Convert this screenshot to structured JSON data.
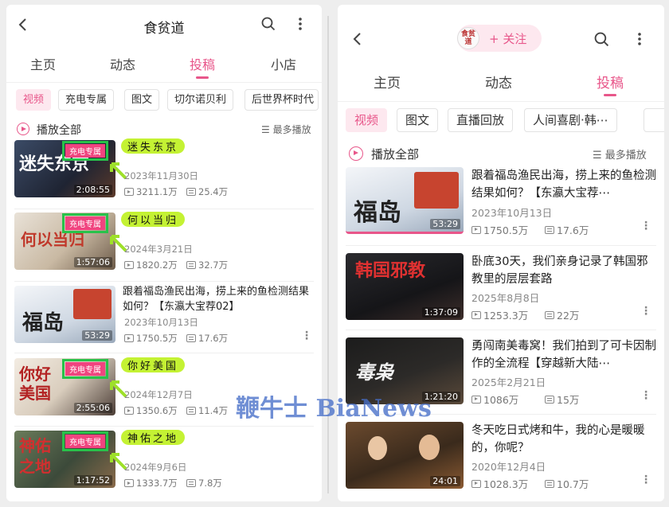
{
  "left": {
    "title": "食贫道",
    "tabs": [
      "主页",
      "动态",
      "投稿",
      "小店"
    ],
    "chips": [
      "视频",
      "充电专属",
      "图文",
      "切尔诺贝利",
      "后世界杯时代"
    ],
    "play_all": "播放全部",
    "sort": "最多播放",
    "videos": [
      {
        "title": "",
        "highlight": "迷失东京",
        "badge": "充电专属",
        "date": "2023年11月30日",
        "views": "3211.1万",
        "danmaku": "25.4万",
        "duration": "2:08:55",
        "thumb_text": "迷失东京"
      },
      {
        "title": "",
        "highlight": "何以当归",
        "badge": "充电专属",
        "date": "2024年3月21日",
        "views": "1820.2万",
        "danmaku": "32.7万",
        "duration": "1:57:06",
        "thumb_text": "何以当归"
      },
      {
        "title": "跟着福岛渔民出海，捞上来的鱼检测结果如何？【东瀛大宝荐02】",
        "highlight": "",
        "badge": "",
        "date": "2023年10月13日",
        "views": "1750.5万",
        "danmaku": "17.6万",
        "duration": "53:29",
        "thumb_text": "福岛"
      },
      {
        "title": "",
        "highlight": "你好美国",
        "badge": "充电专属",
        "date": "2024年12月7日",
        "views": "1350.6万",
        "danmaku": "11.4万",
        "duration": "2:55:06",
        "thumb_text": "你好美国"
      },
      {
        "title": "",
        "highlight": "神佑之地",
        "badge": "充电专属",
        "date": "2024年9月6日",
        "views": "1333.7万",
        "danmaku": "7.8万",
        "duration": "1:17:52",
        "thumb_text": "神佑之地"
      }
    ]
  },
  "right": {
    "avatar_text": "食贫道",
    "follow": "+ 关注",
    "tabs": [
      "主页",
      "动态",
      "投稿"
    ],
    "chips": [
      "视频",
      "图文",
      "直播回放",
      "人间喜剧·韩⋯"
    ],
    "play_all": "播放全部",
    "sort": "最多播放",
    "videos": [
      {
        "title": "跟着福岛渔民出海，捞上来的鱼检测结果如何？【东瀛大宝荐⋯",
        "date": "2023年10月13日",
        "views": "1750.5万",
        "danmaku": "17.6万",
        "duration": "53:29",
        "thumb_text": "福岛"
      },
      {
        "title": "卧底30天，我们亲身记录了韩国邪教里的层层套路",
        "date": "2025年8月8日",
        "views": "1253.3万",
        "danmaku": "22万",
        "duration": "1:37:09",
        "thumb_text": "韩国邪教"
      },
      {
        "title": "勇闯南美毒窝！我们拍到了可卡因制作的全流程【穿越新大陆⋯",
        "date": "2025年2月21日",
        "views": "1086万",
        "danmaku": "15万",
        "duration": "1:21:20",
        "thumb_text": "毒枭"
      },
      {
        "title": "冬天吃日式烤和牛，我的心是暖暖的，你呢？",
        "date": "2020年12月4日",
        "views": "1028.3万",
        "danmaku": "10.7万",
        "duration": "24:01",
        "thumb_text": ""
      }
    ]
  },
  "watermark": "鞭牛士 BiaNews",
  "colors": {
    "accent": "#e8568a",
    "highlight": "#c4f233",
    "badge_border": "#28c24a",
    "badge_bg": "#f0447f"
  }
}
